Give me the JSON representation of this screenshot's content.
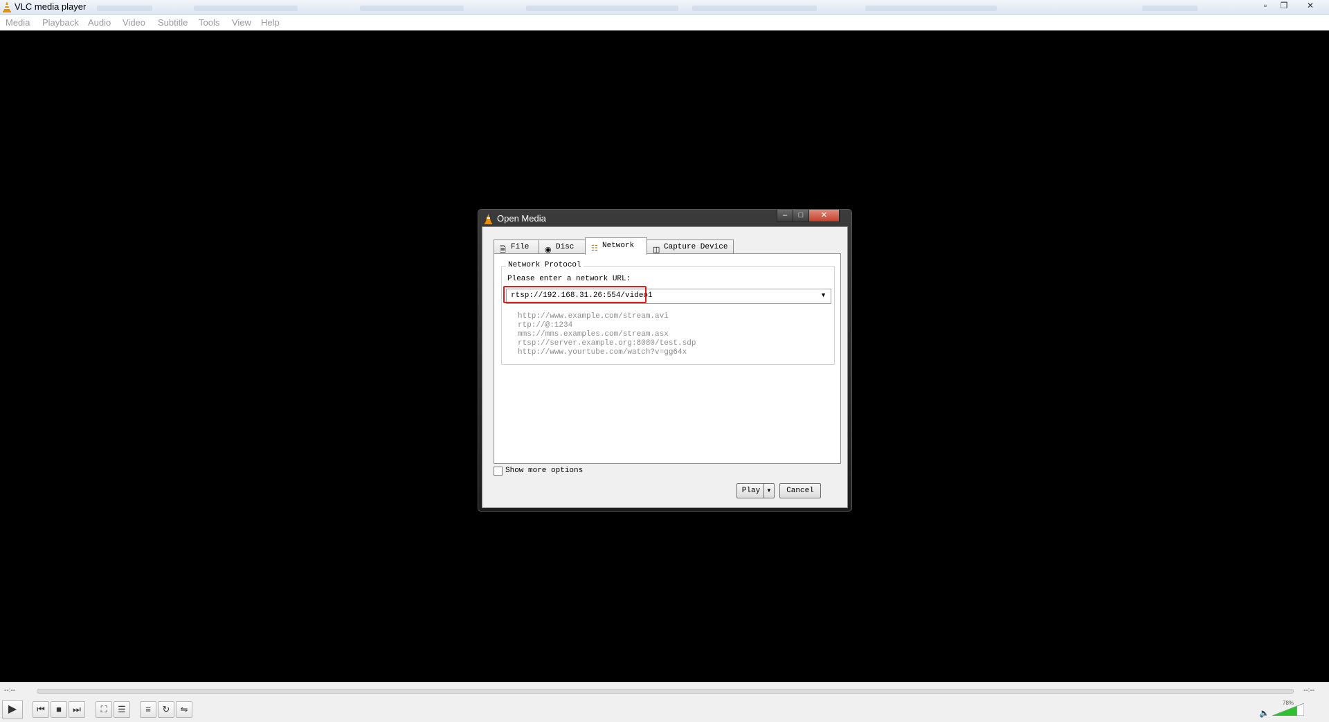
{
  "main_window": {
    "title": "VLC media player",
    "menu": [
      "Media",
      "Playback",
      "Audio",
      "Video",
      "Subtitle",
      "Tools",
      "View",
      "Help"
    ]
  },
  "dialog": {
    "title": "Open Media",
    "tabs": [
      {
        "label": "File",
        "icon": "file-icon",
        "active": false
      },
      {
        "label": "Disc",
        "icon": "disc-icon",
        "active": false
      },
      {
        "label": "Network",
        "icon": "network-icon",
        "active": true
      },
      {
        "label": "Capture Device",
        "icon": "capture-device-icon",
        "active": false
      }
    ],
    "group_label": "Network Protocol",
    "prompt": "Please enter a network URL:",
    "url_value": "rtsp://192.168.31.26:554/video1",
    "examples": [
      "http://www.example.com/stream.avi",
      "rtp://@:1234",
      "mms://mms.examples.com/stream.asx",
      "rtsp://server.example.org:8080/test.sdp",
      "http://www.yourtube.com/watch?v=gg64x"
    ],
    "show_more_options": "Show more options",
    "show_more_checked": false,
    "play_label": "Play",
    "cancel_label": "Cancel"
  },
  "controls": {
    "time_elapsed": "--:--",
    "time_total": "--:--",
    "volume_pct": "78%",
    "volume_level": 0.78
  },
  "colors": {
    "highlight_box": "#e31b1b",
    "volume_fill": "#2fbf2f",
    "vlc_cone": "#f08c00"
  }
}
